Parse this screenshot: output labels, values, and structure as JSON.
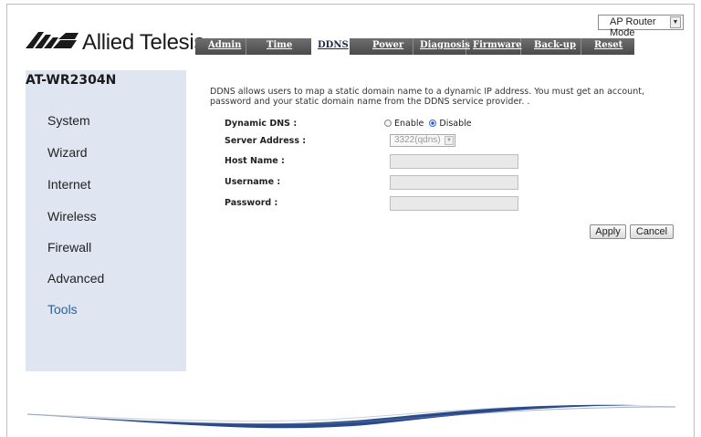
{
  "mode": {
    "selected": "AP Router Mode"
  },
  "brand": {
    "name": "Allied Telesis"
  },
  "tabs": [
    "Admin",
    "Time",
    "DDNS",
    "Power",
    "Diagnosis",
    "Firmware",
    "Back-up",
    "Reset"
  ],
  "active_tab": "DDNS",
  "model": "AT-WR2304N",
  "nav": [
    "System",
    "Wizard",
    "Internet",
    "Wireless",
    "Firewall",
    "Advanced",
    "Tools"
  ],
  "active_nav": "Tools",
  "description": "DDNS allows users to map a static domain name to a dynamic IP address. You must get an account, password and your static domain name from the DDNS service provider. .",
  "form": {
    "dynamic_dns_label": "Dynamic DNS :",
    "enable_label": "Enable",
    "disable_label": "Disable",
    "selected_option": "Disable",
    "server_address_label": "Server Address :",
    "server_address_value": "3322(qdns)",
    "host_name_label": "Host Name :",
    "host_name_value": "",
    "username_label": "Username :",
    "username_value": "",
    "password_label": "Password :",
    "password_value": ""
  },
  "buttons": {
    "apply": "Apply",
    "cancel": "Cancel"
  },
  "colors": {
    "sidebar_bg": "#dfe6f1",
    "tab_bar": "#5a5a5a",
    "active_nav": "#2e5f9e",
    "accent_blue": "#1a3a8a",
    "swoosh": "#2a4a8a"
  }
}
